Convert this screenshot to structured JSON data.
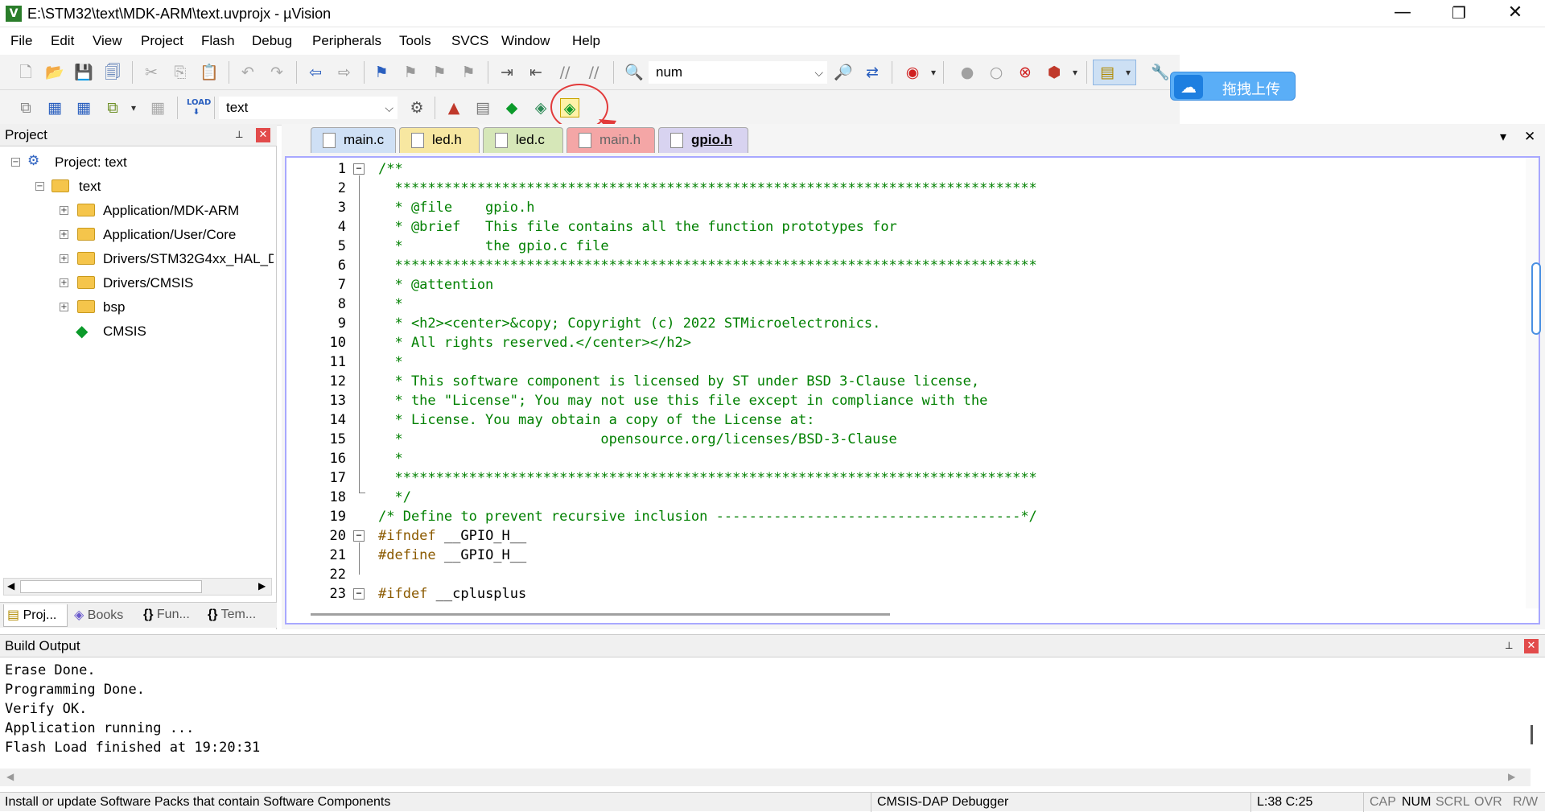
{
  "window": {
    "title": "E:\\STM32\\text\\MDK-ARM\\text.uvprojx - µVision",
    "app_icon": "V",
    "minimize": "—",
    "restore": "❐",
    "close": "✕"
  },
  "menu": [
    "File",
    "Edit",
    "View",
    "Project",
    "Flash",
    "Debug",
    "Peripherals",
    "Tools",
    "SVCS",
    "Window",
    "Help"
  ],
  "toolbar1": {
    "find_combo_value": "num",
    "icons": [
      "new-file-icon",
      "open-file-icon",
      "save-icon",
      "save-all-icon",
      "cut-icon",
      "copy-icon",
      "paste-icon",
      "undo-icon",
      "redo-icon",
      "navigate-back-icon",
      "navigate-forward-icon",
      "bookmark-icon",
      "prev-bookmark-icon",
      "next-bookmark-icon",
      "clear-bookmarks-icon",
      "indent-icon",
      "unindent-icon",
      "comment-icon",
      "uncomment-icon",
      "find-in-files-icon",
      "find-icon",
      "incremental-find-icon",
      "debug-start-icon",
      "breakpoint-icon",
      "breakpoint-disable-icon",
      "breakpoint-kill-icon",
      "breakpoint-options-icon",
      "window-layout-icon",
      "configure-icon"
    ]
  },
  "toolbar2": {
    "target_combo_value": "text",
    "load_label": "LOAD",
    "icons": [
      "translate-icon",
      "build-icon",
      "rebuild-icon",
      "batch-build-icon",
      "stop-build-icon",
      "download-icon",
      "target-options-icon",
      "manage-components-icon",
      "select-packs-icon",
      "pack-installer-icon"
    ]
  },
  "cloud_button": {
    "label": "拖拽上传",
    "icon": "cloud-icon"
  },
  "project_panel": {
    "title": "Project",
    "pin": "📌",
    "close": "✕",
    "tree": [
      {
        "label": "Project: text",
        "level": 0,
        "expander": "−",
        "icon": "project-icon"
      },
      {
        "label": "text",
        "level": 1,
        "expander": "−",
        "icon": "target-folder-icon"
      },
      {
        "label": "Application/MDK-ARM",
        "level": 2,
        "expander": "+",
        "icon": "folder-icon"
      },
      {
        "label": "Application/User/Core",
        "level": 2,
        "expander": "+",
        "icon": "folder-icon"
      },
      {
        "label": "Drivers/STM32G4xx_HAL_D",
        "level": 2,
        "expander": "+",
        "icon": "folder-icon"
      },
      {
        "label": "Drivers/CMSIS",
        "level": 2,
        "expander": "+",
        "icon": "folder-icon"
      },
      {
        "label": "bsp",
        "level": 2,
        "expander": "+",
        "icon": "folder-icon"
      },
      {
        "label": "CMSIS",
        "level": 2,
        "expander": "",
        "icon": "cmsis-component-icon"
      }
    ],
    "tabs": [
      "Proj...",
      "Books",
      "Fun...",
      "Tem..."
    ]
  },
  "editor": {
    "tabs": [
      {
        "label": "main.c",
        "bg": "#cfe0f5",
        "active": false
      },
      {
        "label": "led.h",
        "bg": "#f7e7a1",
        "active": false
      },
      {
        "label": "led.c",
        "bg": "#d6e7b8",
        "active": false
      },
      {
        "label": "main.h",
        "bg": "#f4a6a6",
        "active": false
      },
      {
        "label": "gpio.h",
        "bg": "#d8d3f0",
        "active": true
      }
    ],
    "dropdown": "▾",
    "close": "✕",
    "lines": [
      {
        "n": "1",
        "text": "/**",
        "kind": "c",
        "fold": "−"
      },
      {
        "n": "2",
        "text": "  ******************************************************************************",
        "kind": "c",
        "fold": ""
      },
      {
        "n": "3",
        "text": "  * @file    gpio.h",
        "kind": "c",
        "fold": ""
      },
      {
        "n": "4",
        "text": "  * @brief   This file contains all the function prototypes for",
        "kind": "c",
        "fold": ""
      },
      {
        "n": "5",
        "text": "  *          the gpio.c file",
        "kind": "c",
        "fold": ""
      },
      {
        "n": "6",
        "text": "  ******************************************************************************",
        "kind": "c",
        "fold": ""
      },
      {
        "n": "7",
        "text": "  * @attention",
        "kind": "c",
        "fold": ""
      },
      {
        "n": "8",
        "text": "  *",
        "kind": "c",
        "fold": ""
      },
      {
        "n": "9",
        "text": "  * <h2><center>&copy; Copyright (c) 2022 STMicroelectronics.",
        "kind": "c",
        "fold": ""
      },
      {
        "n": "10",
        "text": "  * All rights reserved.</center></h2>",
        "kind": "c",
        "fold": ""
      },
      {
        "n": "11",
        "text": "  *",
        "kind": "c",
        "fold": ""
      },
      {
        "n": "12",
        "text": "  * This software component is licensed by ST under BSD 3-Clause license,",
        "kind": "c",
        "fold": ""
      },
      {
        "n": "13",
        "text": "  * the \"License\"; You may not use this file except in compliance with the",
        "kind": "c",
        "fold": ""
      },
      {
        "n": "14",
        "text": "  * License. You may obtain a copy of the License at:",
        "kind": "c",
        "fold": ""
      },
      {
        "n": "15",
        "text": "  *                        opensource.org/licenses/BSD-3-Clause",
        "kind": "c",
        "fold": ""
      },
      {
        "n": "16",
        "text": "  *",
        "kind": "c",
        "fold": ""
      },
      {
        "n": "17",
        "text": "  ******************************************************************************",
        "kind": "c",
        "fold": ""
      },
      {
        "n": "18",
        "text": "  */",
        "kind": "c",
        "fold": ""
      },
      {
        "n": "19",
        "text": "/* Define to prevent recursive inclusion -------------------------------------*/",
        "kind": "c",
        "fold": ""
      },
      {
        "n": "20",
        "text": "#ifndef",
        "id": " __GPIO_H__",
        "kind": "pp",
        "fold": "−"
      },
      {
        "n": "21",
        "text": "#define",
        "id": " __GPIO_H__",
        "kind": "pp",
        "fold": ""
      },
      {
        "n": "22",
        "text": "",
        "kind": "c",
        "fold": ""
      },
      {
        "n": "23",
        "text": "#ifdef",
        "id": " __cplusplus",
        "kind": "pp",
        "fold": "−"
      }
    ]
  },
  "build_output": {
    "title": "Build Output",
    "pin": "📌",
    "close": "✕",
    "lines": [
      "Erase Done.",
      "Programming Done.",
      "Verify OK.",
      "Application running ...",
      "Flash Load finished at 19:20:31"
    ]
  },
  "status_bar": {
    "message": "Install or update Software Packs that contain Software Components",
    "debugger": "CMSIS-DAP Debugger",
    "position": "L:38 C:25",
    "cap": "CAP",
    "num": "NUM",
    "scrl": "SCRL",
    "ovr": "OVR",
    "rw": "R/W"
  },
  "annotation_color": "#e23b3b"
}
